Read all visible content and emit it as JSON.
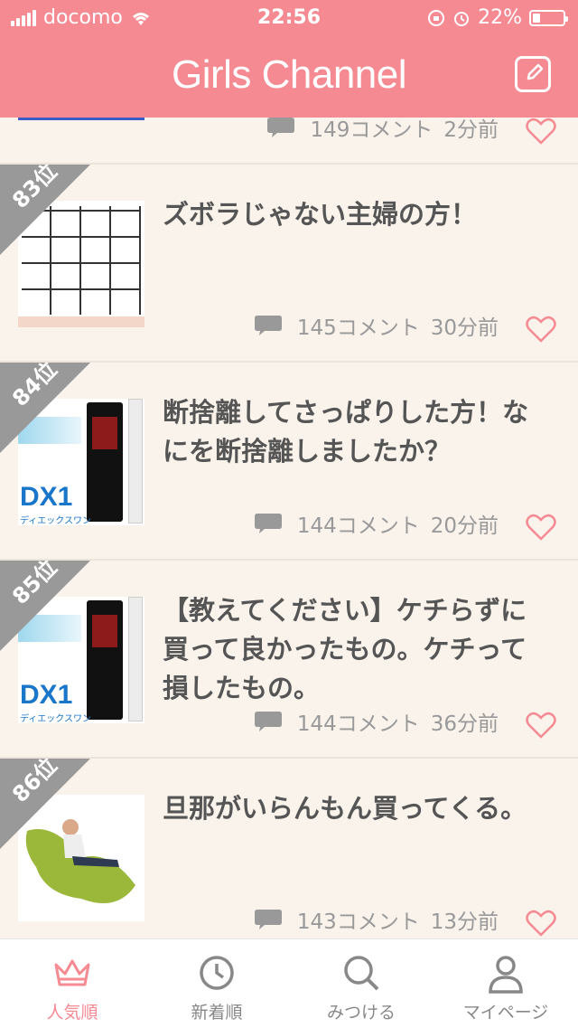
{
  "status": {
    "carrier": "docomo",
    "time": "22:56",
    "battery": "22%"
  },
  "header": {
    "title": "Girls Channel"
  },
  "top_partial": {
    "comments": "149コメント",
    "time": "2分前"
  },
  "items": [
    {
      "rank": "83位",
      "title": "ズボラじゃない主婦の方！",
      "comments": "145コメント",
      "time": "30分前"
    },
    {
      "rank": "84位",
      "title": "断捨離してさっぱりした方！なにを断捨離しましたか？",
      "comments": "144コメント",
      "time": "20分前",
      "thumb_text": "DX1",
      "thumb_sub": "ディエックスワン"
    },
    {
      "rank": "85位",
      "title": "【教えてください】ケチらずに買って良かったもの。ケチって損したもの。",
      "comments": "144コメント",
      "time": "36分前",
      "thumb_text": "DX1",
      "thumb_sub": "ディエックスワン"
    },
    {
      "rank": "86位",
      "title": "旦那がいらんもん買ってくる。",
      "comments": "143コメント",
      "time": "13分前"
    }
  ],
  "tabs": [
    {
      "label": "人気順",
      "icon": "crown-icon",
      "active": true
    },
    {
      "label": "新着順",
      "icon": "clock-icon",
      "active": false
    },
    {
      "label": "みつける",
      "icon": "search-icon",
      "active": false
    },
    {
      "label": "マイページ",
      "icon": "person-icon",
      "active": false
    }
  ],
  "colors": {
    "accent": "#f58a93",
    "background": "#f9f3ec",
    "rank_badge": "#999999"
  }
}
